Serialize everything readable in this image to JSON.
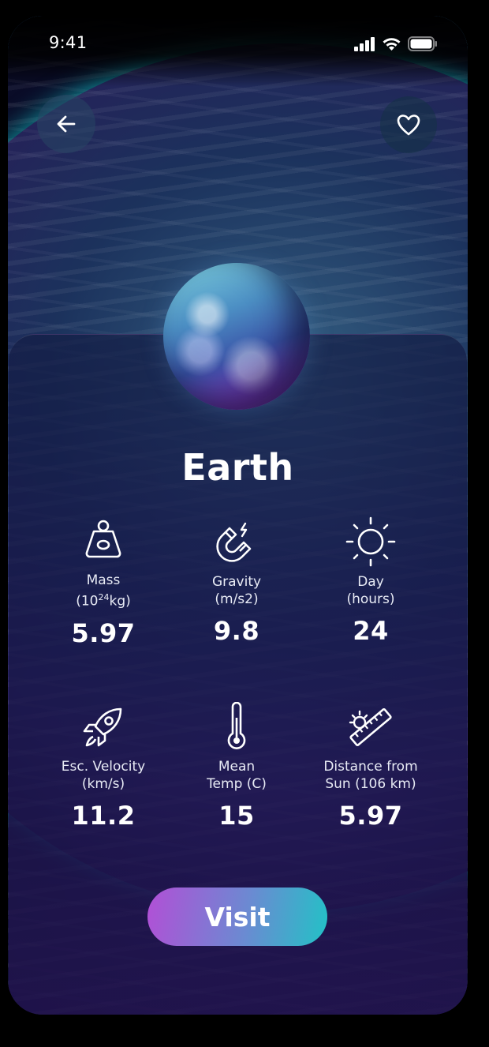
{
  "status_bar": {
    "time": "9:41"
  },
  "planet": {
    "name": "Earth"
  },
  "stats": [
    {
      "label_line1": "Mass",
      "label_line2_pre": "(10",
      "label_line2_sup": "24",
      "label_line2_post": "kg)",
      "value": "5.97",
      "icon": "weight-icon"
    },
    {
      "label_line1": "Gravity",
      "label_line2": "(m/s2)",
      "value": "9.8",
      "icon": "magnet-icon"
    },
    {
      "label_line1": "Day",
      "label_line2": "(hours)",
      "value": "24",
      "icon": "sun-icon"
    },
    {
      "label_line1": "Esc. Velocity",
      "label_line2": "(km/s)",
      "value": "11.2",
      "icon": "rocket-icon"
    },
    {
      "label_line1": "Mean",
      "label_line2": "Temp (C)",
      "value": "15",
      "icon": "thermometer-icon"
    },
    {
      "label_line1": "Distance from",
      "label_line2": "Sun (106 km)",
      "value": "5.97",
      "icon": "sun-ruler-icon"
    }
  ],
  "actions": {
    "visit_label": "Visit"
  },
  "colors": {
    "accent_start": "#b24fd6",
    "accent_end": "#22c2c6"
  }
}
